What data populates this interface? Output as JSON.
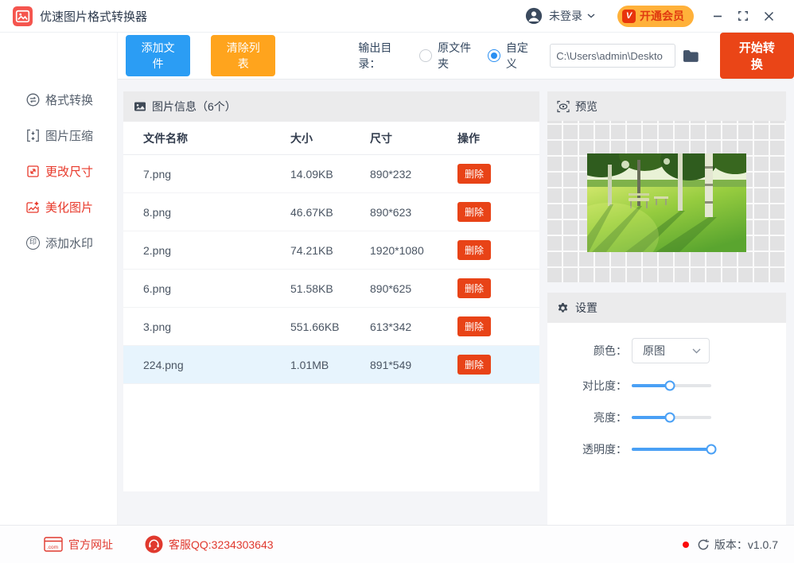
{
  "window": {
    "title": "优速图片格式转换器",
    "login_status": "未登录",
    "vip_button": "开通会员",
    "vip_badge": "V"
  },
  "toolbar": {
    "add_files": "添加文件",
    "clear_list": "清除列表",
    "output_dir_label": "输出目录：",
    "radio_original_folder": "原文件夹",
    "radio_custom": "自定义",
    "path_value": "C:\\Users\\admin\\Deskto",
    "start_convert": "开始转换"
  },
  "sidebar": {
    "items": [
      {
        "label": "格式转换",
        "icon": "convert-icon",
        "active": false
      },
      {
        "label": "图片压缩",
        "icon": "compress-icon",
        "active": false
      },
      {
        "label": "更改尺寸",
        "icon": "resize-icon",
        "active": true
      },
      {
        "label": "美化图片",
        "icon": "beautify-icon",
        "active": true
      },
      {
        "label": "添加水印",
        "icon": "watermark-icon",
        "active": false
      }
    ],
    "watermark_glyph": "印"
  },
  "table": {
    "panel_title": "图片信息（6个）",
    "headers": {
      "name": "文件名称",
      "size": "大小",
      "dims": "尺寸",
      "action": "操作"
    },
    "delete_label": "删除",
    "rows": [
      {
        "name": "7.png",
        "size": "14.09KB",
        "dims": "890*232",
        "selected": false
      },
      {
        "name": "8.png",
        "size": "46.67KB",
        "dims": "890*623",
        "selected": false
      },
      {
        "name": "2.png",
        "size": "74.21KB",
        "dims": "1920*1080",
        "selected": false
      },
      {
        "name": "6.png",
        "size": "51.58KB",
        "dims": "890*625",
        "selected": false
      },
      {
        "name": "3.png",
        "size": "551.66KB",
        "dims": "613*342",
        "selected": false
      },
      {
        "name": "224.png",
        "size": "1.01MB",
        "dims": "891*549",
        "selected": true
      }
    ]
  },
  "preview": {
    "title": "预览"
  },
  "settings": {
    "title": "设置",
    "color_label": "颜色：",
    "color_value": "原图",
    "sliders": [
      {
        "label": "对比度：",
        "percent": 48
      },
      {
        "label": "亮度：",
        "percent": 48
      },
      {
        "label": "透明度：",
        "percent": 100
      }
    ]
  },
  "footer": {
    "official_site": "官方网址",
    "service_qq": "客服QQ:3234303643",
    "version_label": "版本：",
    "version_value": "v1.0.7"
  },
  "colors": {
    "accent_blue": "#2b9df4",
    "accent_orange": "#ffa41d",
    "accent_red": "#ea4517",
    "delete_red": "#e84317",
    "vip_pill": "#ffb13a",
    "vip_text": "#e03a10",
    "sidebar_active": "#e8382a",
    "row_highlight": "#e7f4fd",
    "slider_blue": "#4aa0f5",
    "footer_red": "#e0392e"
  }
}
